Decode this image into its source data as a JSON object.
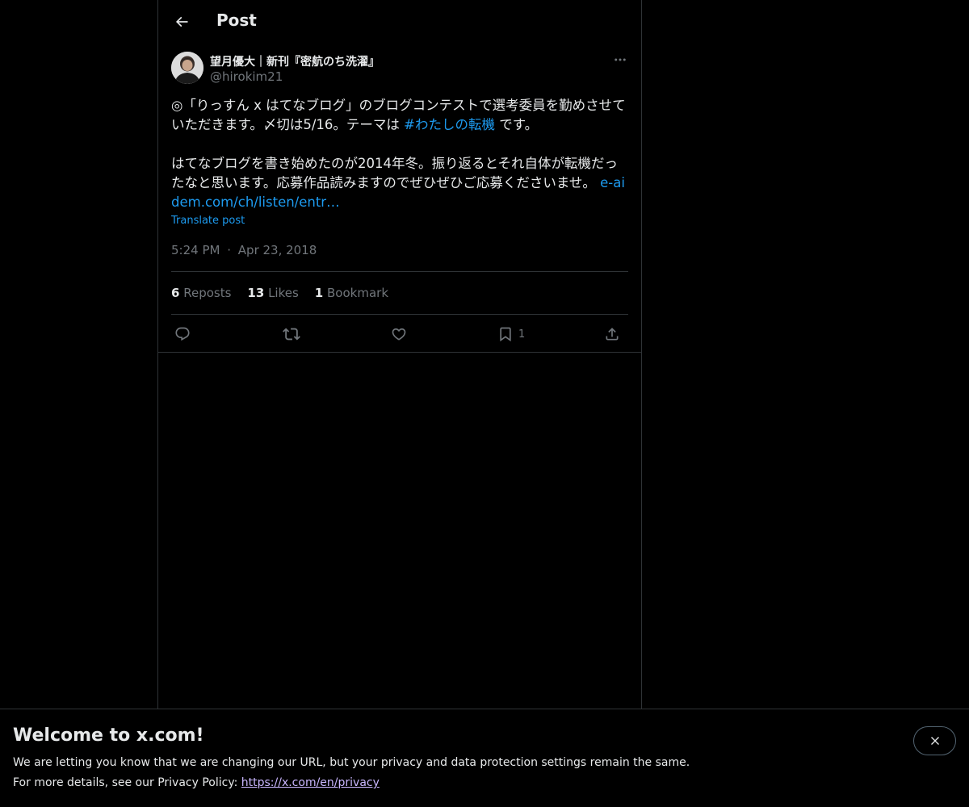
{
  "header": {
    "title": "Post"
  },
  "post": {
    "author_name": "望月優大｜新刊『密航のち洗濯』",
    "author_handle": "@hirokim21",
    "text_line1_a": "◎「りっすん x はてなブログ」のブログコンテストで選考委員を勤めさせていただきます。〆切は5/16。テーマは ",
    "hashtag": "#わたしの転機",
    "text_line1_b": " です。",
    "text_para2": "はてなブログを書き始めたのが2014年冬。振り返るとそれ自体が転機だったなと思います。応募作品読みますのでぜひぜひご応募くださいませ。 ",
    "link_text": "e-aidem.com/ch/listen/entr…",
    "translate_label": "Translate post",
    "time": "5:24 PM",
    "dot": "·",
    "date": "Apr 23, 2018"
  },
  "stats": {
    "reposts_count": "6",
    "reposts_label": "Reposts",
    "likes_count": "13",
    "likes_label": "Likes",
    "bookmarks_count": "1",
    "bookmarks_label": "Bookmark"
  },
  "actions": {
    "bookmark_count": "1",
    "icons": [
      "reply-icon",
      "repost-icon",
      "like-icon",
      "bookmark-icon",
      "share-icon"
    ]
  },
  "banner": {
    "title": "Welcome to x.com!",
    "line1": "We are letting you know that we are changing our URL, but your privacy and data protection settings remain the same.",
    "line2_prefix": "For more details, see our Privacy Policy: ",
    "line2_link": "https://x.com/en/privacy"
  },
  "colors": {
    "background": "#000000",
    "text": "#e7e9ea",
    "muted": "#71767b",
    "accent": "#1d9bf0",
    "border": "#2f3336",
    "privacy_link": "#c9b6ff"
  }
}
